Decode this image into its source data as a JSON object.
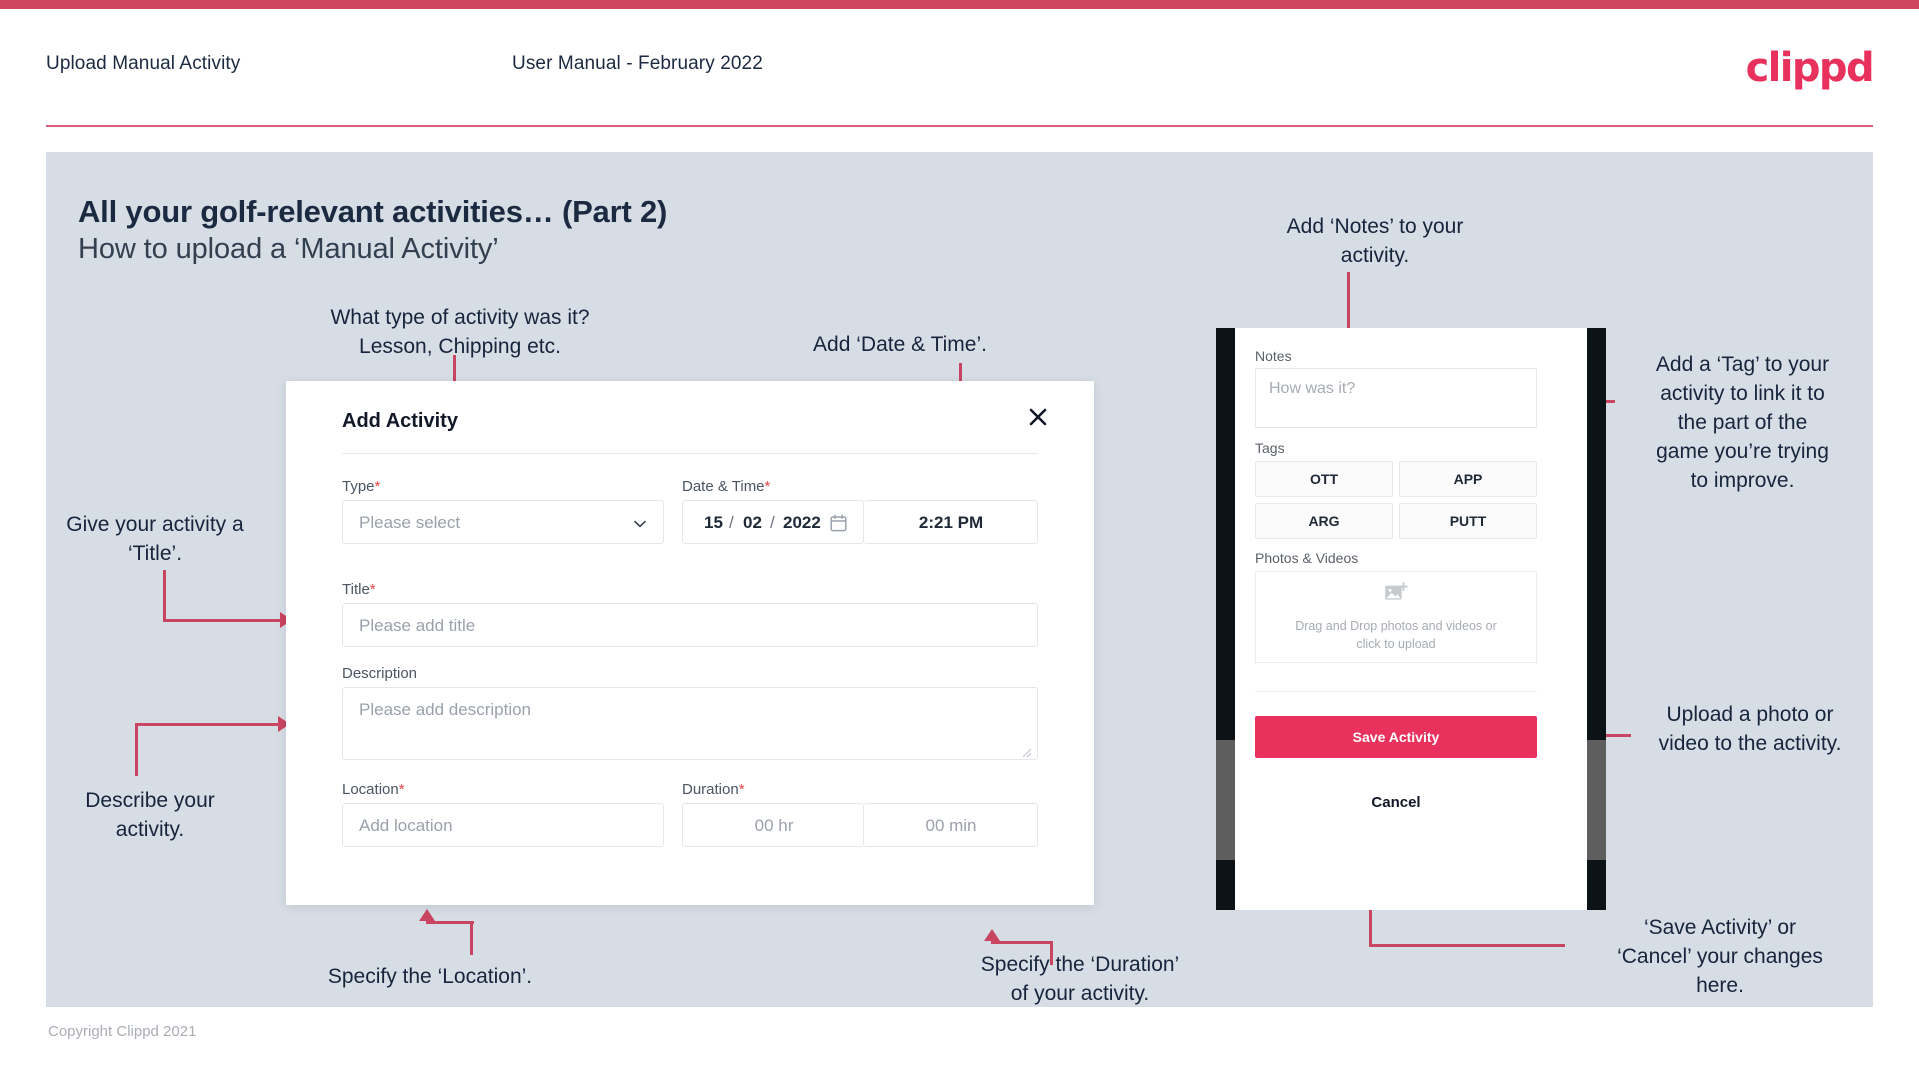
{
  "header": {
    "left_title": "Upload Manual Activity",
    "center_title": "User Manual - February 2022",
    "logo": "clippd"
  },
  "slide": {
    "title_line1": "All your golf-relevant activities… (Part 2)",
    "title_line2": "How to upload a ‘Manual Activity’",
    "copyright": "Copyright Clippd 2021"
  },
  "annotations": {
    "type": "What type of activity was it?\nLesson, Chipping etc.",
    "datetime": "Add ‘Date & Time’.",
    "title": "Give your activity a\n‘Title’.",
    "description": "Describe your\nactivity.",
    "location": "Specify the ‘Location’.",
    "duration": "Specify the ‘Duration’\nof your activity.",
    "notes": "Add ‘Notes’ to your\nactivity.",
    "tags": "Add a ‘Tag’ to your\nactivity to link it to\nthe part of the\ngame you’re trying\nto improve.",
    "upload": "Upload a photo or\nvideo to the activity.",
    "save_cancel": "‘Save Activity’ or\n‘Cancel’ your changes\nhere."
  },
  "dialog": {
    "title": "Add Activity",
    "close_icon": "close-icon",
    "fields": {
      "type": {
        "label": "Type",
        "required": "*",
        "placeholder": "Please select",
        "icon": "chevron-down-icon"
      },
      "datetime": {
        "label": "Date & Time",
        "required": "*",
        "day": "15",
        "sep1": "/",
        "month": "02",
        "sep2": "/",
        "year": "2022",
        "calendar_icon": "calendar-icon",
        "time": "2:21 PM"
      },
      "title": {
        "label": "Title",
        "required": "*",
        "placeholder": "Please add title"
      },
      "description": {
        "label": "Description",
        "required": "",
        "placeholder": "Please add description"
      },
      "location": {
        "label": "Location",
        "required": "*",
        "placeholder": "Add location"
      },
      "duration": {
        "label": "Duration",
        "required": "*",
        "hours_placeholder": "00 hr",
        "minutes_placeholder": "00 min"
      }
    }
  },
  "phone": {
    "notes": {
      "label": "Notes",
      "placeholder": "How was it?"
    },
    "tags": {
      "label": "Tags",
      "options": [
        "OTT",
        "APP",
        "ARG",
        "PUTT"
      ]
    },
    "media": {
      "label": "Photos & Videos",
      "icon": "add-image-icon",
      "drop_text_line1": "Drag and Drop photos and videos or",
      "drop_text_line2": "click to upload"
    },
    "save_label": "Save Activity",
    "cancel_label": "Cancel"
  },
  "colors": {
    "brand_pink": "#e8315c",
    "rule_red": "#cf4460",
    "annotation_line": "#c94561",
    "slide_bg": "#d7dde4",
    "text_dark": "#1b2a41"
  }
}
